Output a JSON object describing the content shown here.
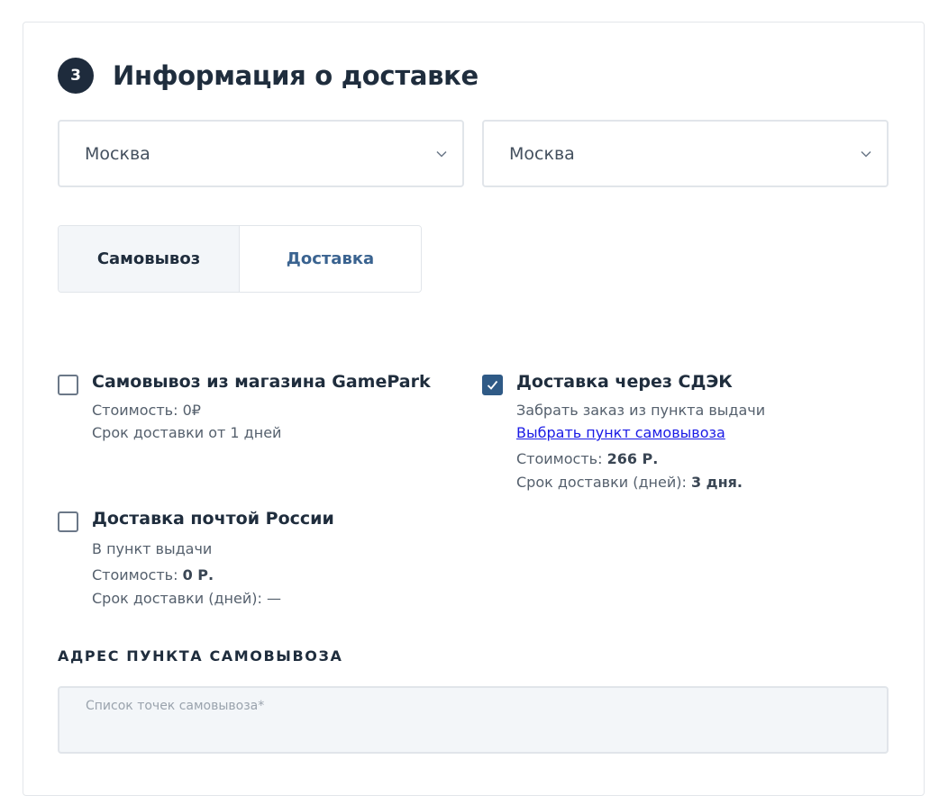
{
  "section": {
    "step": "3",
    "title": "Информация о доставке"
  },
  "selects": {
    "region": "Москва",
    "city": "Москва"
  },
  "tabs": {
    "pickup": "Самовывоз",
    "delivery": "Доставка"
  },
  "options": {
    "store": {
      "checked": false,
      "title": "Самовывоз из магазина GamePark",
      "cost": "Стоимость: 0₽",
      "term": "Срок доставки от 1 дней"
    },
    "cdek": {
      "checked": true,
      "title": "Доставка через СДЭК",
      "subtitle": "Забрать заказ из пункта выдачи",
      "link": "Выбрать пункт самовывоза",
      "cost_label": "Стоимость: ",
      "cost_value": "266 Р.",
      "term_label": "Срок доставки (дней): ",
      "term_value": "3 дня."
    },
    "post": {
      "checked": false,
      "title": "Доставка почтой России",
      "subtitle": "В пункт выдачи",
      "cost_label": "Стоимость: ",
      "cost_value": "0 Р.",
      "term": "Срок доставки (дней): —"
    }
  },
  "address": {
    "label": "АДРЕС ПУНКТА САМОВЫВОЗА",
    "placeholder": "Список точек самовывоза*"
  },
  "colors": {
    "badge": "#1e2b3c",
    "accent": "#2f5a86",
    "link": "#1a1ae6"
  }
}
